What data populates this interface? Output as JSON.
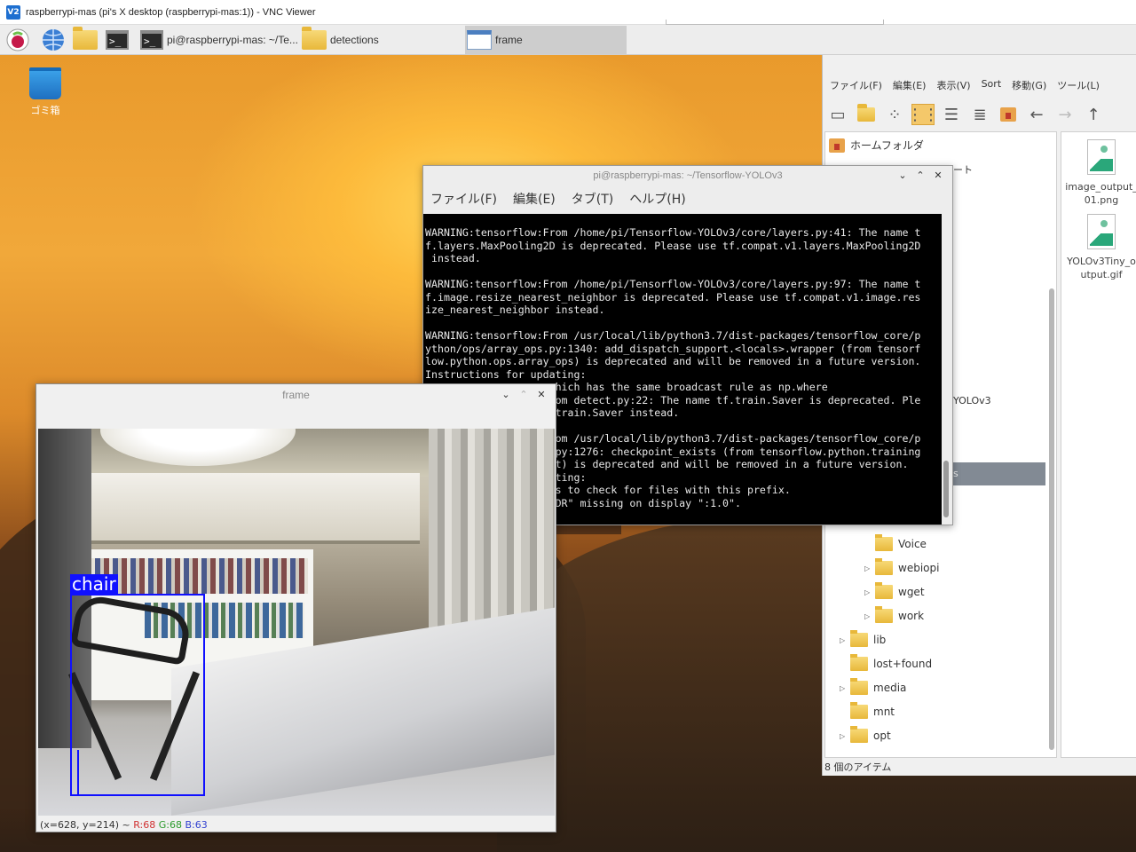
{
  "vnc": {
    "title": "raspberrypi-mas (pi's X desktop (raspberrypi-mas:1)) - VNC Viewer",
    "logo_text": "V2"
  },
  "taskbar": {
    "terminal_task_label": "pi@raspberrypi-mas: ~/Te...",
    "detections_task_label": "detections",
    "frame_task_label": "frame"
  },
  "desktop": {
    "trash_label": "ゴミ箱"
  },
  "file_manager": {
    "menu": [
      "ファイル(F)",
      "編集(E)",
      "表示(V)",
      "Sort",
      "移動(G)",
      "ツール(L)"
    ],
    "home_label": "ホームフォルダ",
    "partial_top_label": "ート",
    "partial_folder_label": "YOLOv3",
    "partial_sel_label": "s",
    "tree": [
      {
        "label": "Voice",
        "expandable": false
      },
      {
        "label": "webiopi",
        "expandable": true
      },
      {
        "label": "wget",
        "expandable": true
      },
      {
        "label": "work",
        "expandable": true
      },
      {
        "label": "lib",
        "expandable": true
      },
      {
        "label": "lost+found",
        "expandable": false
      },
      {
        "label": "media",
        "expandable": true
      },
      {
        "label": "mnt",
        "expandable": false
      },
      {
        "label": "opt",
        "expandable": true
      }
    ],
    "files": [
      {
        "name_line1": "image_output_",
        "name_line2": "01.png"
      },
      {
        "name_line1": "YOLOv3Tiny_o",
        "name_line2": "utput.gif"
      }
    ],
    "status": "8 個のアイテム"
  },
  "terminal": {
    "title": "pi@raspberrypi-mas: ~/Tensorflow-YOLOv3",
    "menu": [
      "ファイル(F)",
      "編集(E)",
      "タブ(T)",
      "ヘルプ(H)"
    ],
    "lines": [
      "WARNING:tensorflow:From /home/pi/Tensorflow-YOLOv3/core/layers.py:41: The name t",
      "f.layers.MaxPooling2D is deprecated. Please use tf.compat.v1.layers.MaxPooling2D",
      " instead.",
      "",
      "WARNING:tensorflow:From /home/pi/Tensorflow-YOLOv3/core/layers.py:97: The name t",
      "f.image.resize_nearest_neighbor is deprecated. Please use tf.compat.v1.image.res",
      "ize_nearest_neighbor instead.",
      "",
      "WARNING:tensorflow:From /usr/local/lib/python3.7/dist-packages/tensorflow_core/p",
      "ython/ops/array_ops.py:1340: add_dispatch_support.<locals>.wrapper (from tensorf",
      "low.python.ops.array_ops) is deprecated and will be removed in a future version.",
      "Instructions for updating:",
      "                    which has the same broadcast rule as np.where",
      "                    rom detect.py:22: The name tf.train.Saver is deprecated. Ple",
      "                    .train.Saver instead.",
      "",
      "                    rom /usr/local/lib/python3.7/dist-packages/tensorflow_core/p",
      "                    .py:1276: checkpoint_exists (from tensorflow.python.training",
      "                    nt) is deprecated and will be removed in a future version.",
      "                    ating:",
      "                    Is to check for files with this prefix.",
      "                    NDR\" missing on display \":1.0\"."
    ]
  },
  "frame_window": {
    "title": "frame",
    "detection_label": "chair",
    "status_coords": "(x=628, y=214) ~",
    "status_r": "R:68",
    "status_g": "G:68",
    "status_b": "B:63"
  },
  "colors": {
    "bbox": "#1010ff",
    "r_text": "#d03030",
    "g_text": "#2a9a2a",
    "b_text": "#3040d0"
  }
}
